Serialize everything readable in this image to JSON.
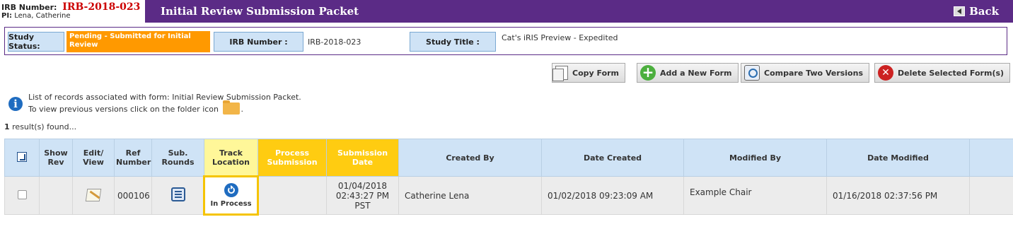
{
  "header": {
    "irb_label": "IRB Number:",
    "irb_value": "IRB-2018-023",
    "pi_label": "PI:",
    "pi_value": "Lena, Catherine",
    "title": "Initial Review Submission Packet",
    "back_label": "Back",
    "bar_color": "#5b2b86"
  },
  "study": {
    "status_label": "Study Status:",
    "status_value": "Pending - Submitted for Initial Review",
    "irb_label": "IRB Number :",
    "irb_value": "IRB-2018-023",
    "title_label": "Study Title :",
    "title_value": "Cat's iRIS Preview - Expedited"
  },
  "toolbar": {
    "copy": "Copy Form",
    "add": "Add a New Form",
    "compare": "Compare Two Versions",
    "delete": "Delete Selected Form(s)"
  },
  "info": {
    "line1": "List of records associated with form: Initial Review Submission Packet.",
    "line2_pre": "To view previous versions click on the folder icon",
    "line2_post": "."
  },
  "results": {
    "count": "1",
    "text": "result(s) found..."
  },
  "table": {
    "headers": {
      "show_rev": "Show Rev",
      "edit_view": "Edit/ View",
      "ref_number": "Ref Number",
      "sub_rounds": "Sub. Rounds",
      "track_location": "Track Location",
      "process_submission": "Process Submission",
      "submission_date": "Submission Date",
      "created_by": "Created By",
      "date_created": "Date Created",
      "modified_by": "Modified By",
      "date_modified": "Date Modified"
    },
    "rows": [
      {
        "ref_number": "000106",
        "track_status": "In Process",
        "submission_date_1": "01/04/2018",
        "submission_date_2": "02:43:27 PM PST",
        "created_by": "Catherine Lena",
        "date_created": "01/02/2018 09:23:09 AM",
        "modified_by": "Example Chair",
        "date_modified": "01/16/2018 02:37:56 PM"
      }
    ]
  }
}
